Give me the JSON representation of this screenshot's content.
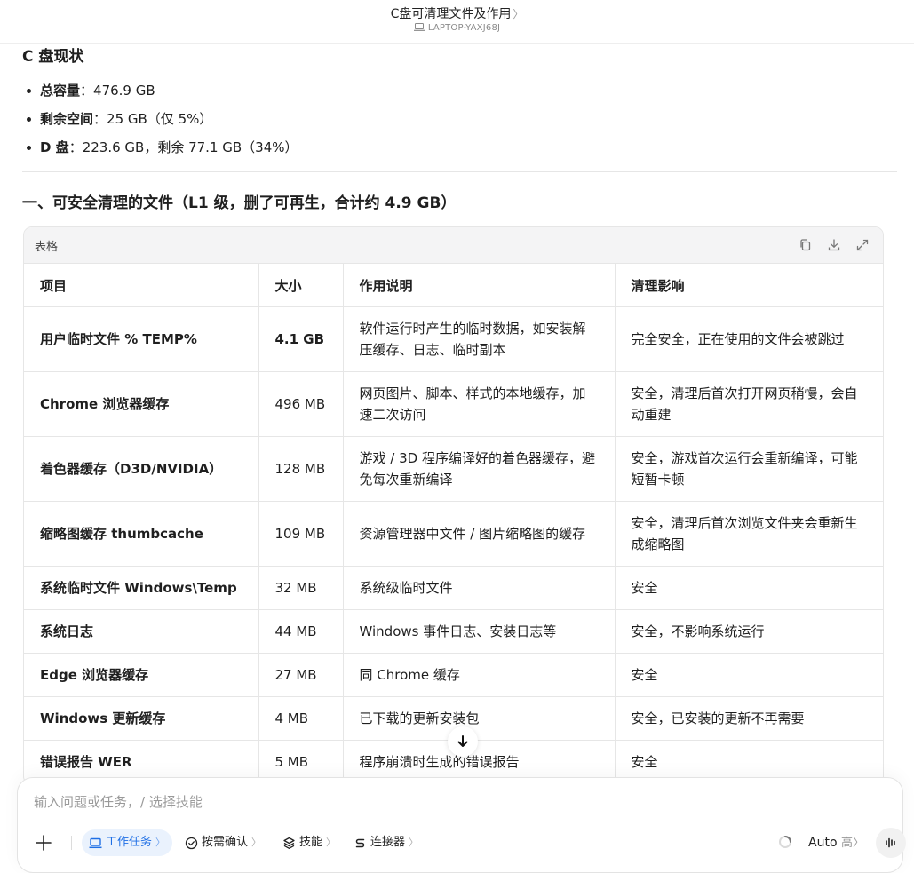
{
  "topbar": {
    "title": "C盘可清理文件及作用",
    "title_chevron": "〉",
    "device": "LAPTOP-YAXJ68J"
  },
  "status": {
    "heading": "C 盘现状",
    "items": [
      {
        "label": "总容量",
        "sep": "：",
        "value": "476.9 GB"
      },
      {
        "label": "剩余空间",
        "sep": "：",
        "value": "25 GB（仅 5%）"
      },
      {
        "label": "D 盘",
        "sep": "：",
        "value": "223.6 GB，剩余 77.1 GB（34%）"
      }
    ]
  },
  "section1": {
    "heading": "一、可安全清理的文件（L1 级，删了可再生，合计约 4.9 GB）"
  },
  "table": {
    "card_label": "表格",
    "tools": [
      "copy-icon",
      "download-icon",
      "expand-icon"
    ],
    "headers": [
      "项目",
      "大小",
      "作用说明",
      "清理影响"
    ],
    "rows": [
      {
        "item": "用户临时文件 % TEMP%",
        "size": "4.1 GB",
        "desc": "软件运行时产生的临时数据，如安装解压缓存、日志、临时副本",
        "impact": "完全安全，正在使用的文件会被跳过"
      },
      {
        "item": "Chrome 浏览器缓存",
        "size": "496 MB",
        "desc": "网页图片、脚本、样式的本地缓存，加速二次访问",
        "impact": "安全，清理后首次打开网页稍慢，会自动重建"
      },
      {
        "item": "着色器缓存（D3D/NVIDIA）",
        "size": "128 MB",
        "desc": "游戏 / 3D 程序编译好的着色器缓存，避免每次重新编译",
        "impact": "安全，游戏首次运行会重新编译，可能短暂卡顿"
      },
      {
        "item": "缩略图缓存 thumbcache",
        "size": "109 MB",
        "desc": "资源管理器中文件 / 图片缩略图的缓存",
        "impact": "安全，清理后首次浏览文件夹会重新生成缩略图"
      },
      {
        "item": "系统临时文件 Windows\\Temp",
        "size": "32 MB",
        "desc": "系统级临时文件",
        "impact": "安全"
      },
      {
        "item": "系统日志",
        "size": "44 MB",
        "desc": "Windows 事件日志、安装日志等",
        "impact": "安全，不影响系统运行"
      },
      {
        "item": "Edge 浏览器缓存",
        "size": "27 MB",
        "desc": "同 Chrome 缓存",
        "impact": "安全"
      },
      {
        "item": "Windows 更新缓存",
        "size": "4 MB",
        "desc": "已下载的更新安装包",
        "impact": "安全，已安装的更新不再需要"
      },
      {
        "item": "错误报告 WER",
        "size": "5 MB",
        "desc": "程序崩溃时生成的错误报告",
        "impact": "安全"
      }
    ]
  },
  "composer": {
    "placeholder": "输入问题或任务，/ 选择技能",
    "chips": [
      {
        "label": "工作任务",
        "icon": "laptop-icon",
        "active": true
      },
      {
        "label": "按需确认",
        "icon": "check-circle-icon",
        "active": false
      },
      {
        "label": "技能",
        "icon": "layers-icon",
        "active": false
      },
      {
        "label": "连接器",
        "icon": "connector-icon",
        "active": false
      }
    ],
    "model": "Auto",
    "level": "高",
    "chevron": "〉",
    "accent": "#1f6fe5"
  }
}
